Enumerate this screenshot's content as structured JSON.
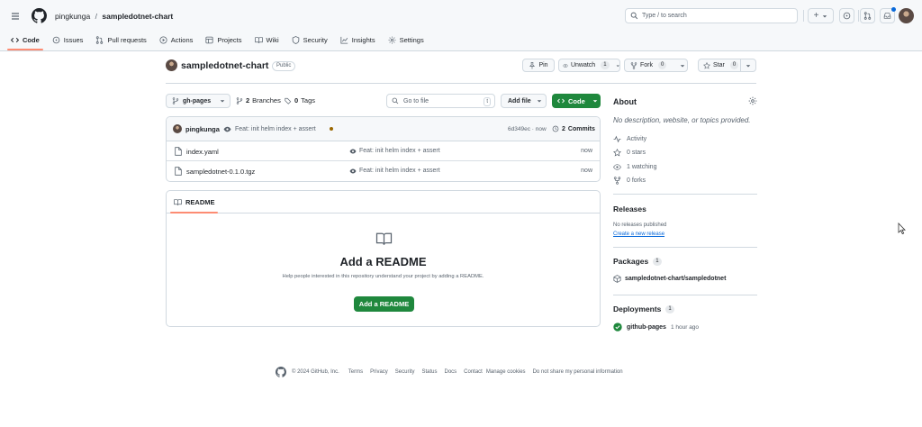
{
  "header": {
    "owner": "pingkunga",
    "slash": "/",
    "repo": "sampledotnet-chart",
    "search_placeholder": "Type / to search",
    "plus": "+"
  },
  "tabs": [
    {
      "label": "Code",
      "icon": "code-icon",
      "active": true
    },
    {
      "label": "Issues",
      "icon": "issue-icon"
    },
    {
      "label": "Pull requests",
      "icon": "pull-request-icon"
    },
    {
      "label": "Actions",
      "icon": "play-icon"
    },
    {
      "label": "Projects",
      "icon": "table-icon"
    },
    {
      "label": "Wiki",
      "icon": "book-icon"
    },
    {
      "label": "Security",
      "icon": "shield-icon"
    },
    {
      "label": "Insights",
      "icon": "graph-icon"
    },
    {
      "label": "Settings",
      "icon": "gear-icon"
    }
  ],
  "repo_header": {
    "name": "sampledotnet-chart",
    "visibility": "Public",
    "pin": "Pin",
    "unwatch": "Unwatch",
    "watch_count": "1",
    "fork": "Fork",
    "fork_count": "0",
    "star": "Star",
    "star_count": "0"
  },
  "toolbar": {
    "branch": "gh-pages",
    "branches_count": "2",
    "branches_label": "Branches",
    "tags_count": "0",
    "tags_label": "Tags",
    "goto_placeholder": "Go to file",
    "goto_key": "t",
    "add_file": "Add file",
    "code": "Code"
  },
  "commit": {
    "author": "pingkunga",
    "message": "Feat: init helm index + assert",
    "hash": "6d349ec · now",
    "commits_count": "2",
    "commits_label": "Commits"
  },
  "files": [
    {
      "name": "index.yaml",
      "message": "Feat: init helm index + assert",
      "time": "now"
    },
    {
      "name": "sampledotnet-0.1.0.tgz",
      "message": "Feat: init helm index + assert",
      "time": "now"
    }
  ],
  "readme": {
    "tab": "README",
    "title": "Add a README",
    "description": "Help people interested in this repository understand your project by adding a README.",
    "button": "Add a README"
  },
  "about": {
    "title": "About",
    "description": "No description, website, or topics provided.",
    "activity": "Activity",
    "stars": "0 stars",
    "watching": "1 watching",
    "forks": "0 forks"
  },
  "releases": {
    "title": "Releases",
    "none": "No releases published",
    "create": "Create a new release"
  },
  "packages": {
    "title": "Packages",
    "count": "1",
    "item": "sampledotnet-chart/sampledotnet"
  },
  "deployments": {
    "title": "Deployments",
    "count": "1",
    "env": "github-pages",
    "time": "1 hour ago"
  },
  "footer": {
    "copyright": "© 2024 GitHub, Inc.",
    "links": [
      "Terms",
      "Privacy",
      "Security",
      "Status",
      "Docs",
      "Contact",
      "Manage cookies",
      "Do not share my personal information"
    ]
  },
  "colors": {
    "primary_green": "#1f883d",
    "accent_orange": "#fd8c73",
    "link_blue": "#0969da",
    "commit_dot": "#9a6700"
  }
}
